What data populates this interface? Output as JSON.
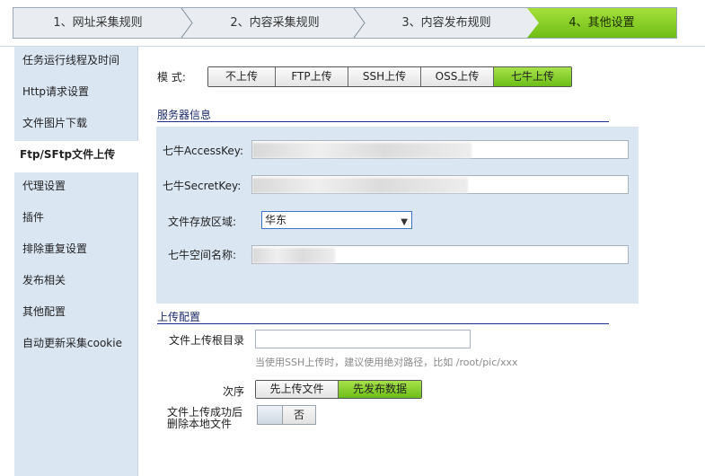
{
  "steps": [
    {
      "label": "1、网址采集规则"
    },
    {
      "label": "2、内容采集规则"
    },
    {
      "label": "3、内容发布规则"
    },
    {
      "label": "4、其他设置"
    }
  ],
  "sidebar": {
    "items": [
      {
        "label": "任务运行线程及时间"
      },
      {
        "label": "Http请求设置"
      },
      {
        "label": "文件图片下载"
      },
      {
        "label": "Ftp/SFtp文件上传"
      },
      {
        "label": "代理设置"
      },
      {
        "label": "插件"
      },
      {
        "label": "排除重复设置"
      },
      {
        "label": "发布相关"
      },
      {
        "label": "其他配置"
      },
      {
        "label": "自动更新采集cookie"
      }
    ]
  },
  "mode": {
    "label": "模  式:",
    "options": [
      "不上传",
      "FTP上传",
      "SSH上传",
      "OSS上传",
      "七牛上传"
    ],
    "selected": "七牛上传"
  },
  "server": {
    "title": "服务器信息",
    "access_key_label": "七牛AccessKey:",
    "secret_key_label": "七牛SecretKey:",
    "region_label": "文件存放区域:",
    "region_value": "华东",
    "bucket_label": "七牛空间名称:"
  },
  "upload": {
    "title": "上传配置",
    "root_dir_label": "文件上传根目录",
    "root_dir_value": "",
    "hint": "当使用SSH上传时，建议使用绝对路径，比如  /root/pic/xxx",
    "order_label": "次序",
    "order_options": [
      "先上传文件",
      "先发布数据"
    ],
    "order_selected": "先发布数据",
    "delete_label_1": "文件上传成功后",
    "delete_label_2": "删除本地文件",
    "delete_toggle_value": "否"
  }
}
